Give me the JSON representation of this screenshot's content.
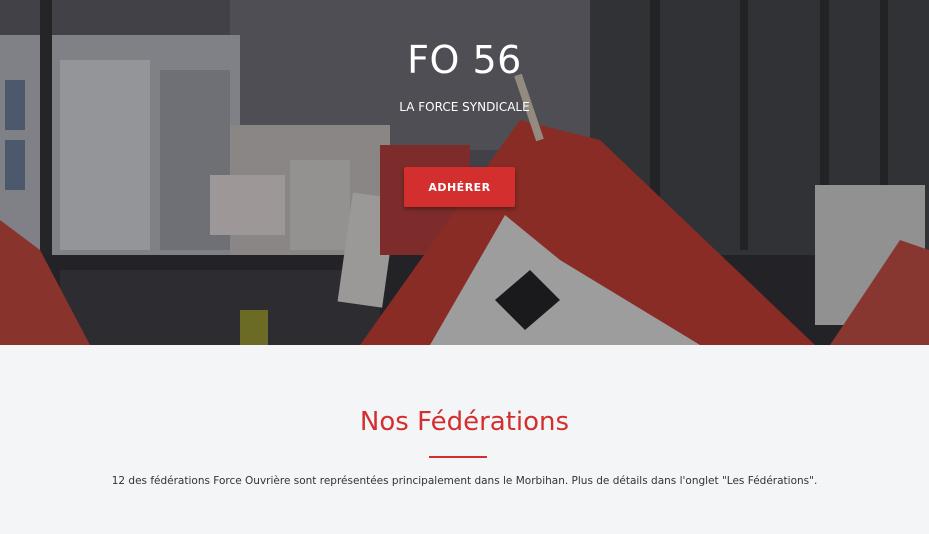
{
  "hero": {
    "title": "FO 56",
    "subtitle": "LA FORCE SYNDICALE",
    "button_label": "ADHÉRER"
  },
  "federations": {
    "title": "Nos Fédérations",
    "description": "12 des fédérations Force Ouvrière sont représentées principalement dans le Morbihan. Plus de détails dans l'onglet \"Les Fédérations\"."
  },
  "colors": {
    "accent": "#d32f2f",
    "section_background": "#f4f5f7",
    "hero_text": "#ffffff"
  }
}
